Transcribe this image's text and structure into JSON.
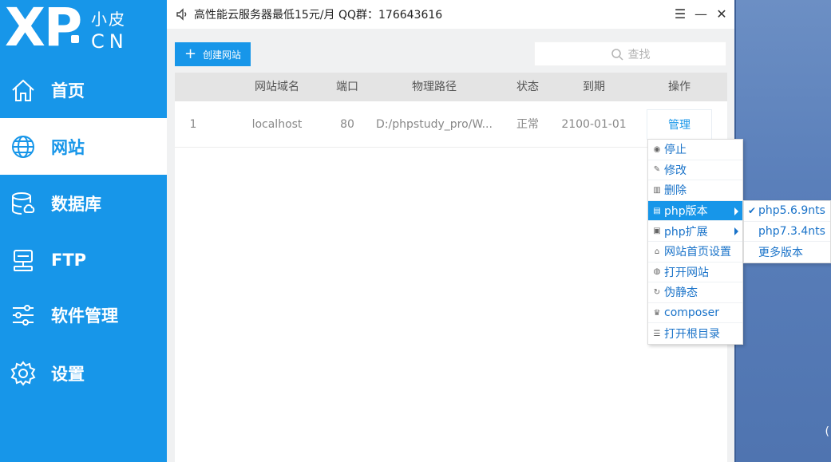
{
  "logo": {
    "main": "XP",
    "cn_top": "小皮",
    "cn_bottom": "CN"
  },
  "sidebar": {
    "items": [
      {
        "label": "首页",
        "icon": "home-icon"
      },
      {
        "label": "网站",
        "icon": "globe-icon",
        "active": true
      },
      {
        "label": "数据库",
        "icon": "database-icon"
      },
      {
        "label": "FTP",
        "icon": "server-icon"
      },
      {
        "label": "软件管理",
        "icon": "sliders-icon"
      },
      {
        "label": "设置",
        "icon": "gear-icon"
      }
    ]
  },
  "titlebar": {
    "notice": "高性能云服务器最低15元/月  QQ群：176643616",
    "buttons": {
      "menu": "☰",
      "minimize": "—",
      "close": "✕"
    }
  },
  "toolbar": {
    "create_label": "创建网站",
    "search_placeholder": "查找"
  },
  "table": {
    "headers": [
      "网站域名",
      "端口",
      "物理路径",
      "状态",
      "到期",
      "操作"
    ],
    "rows": [
      {
        "index": "1",
        "domain": "localhost",
        "port": "80",
        "path": "D:/phpstudy_pro/W...",
        "status": "正常",
        "expire": "2100-01-01",
        "action": "管理"
      }
    ]
  },
  "context_menu": {
    "items": [
      {
        "label": "停止",
        "icon": "stop-icon"
      },
      {
        "label": "修改",
        "icon": "edit-icon"
      },
      {
        "label": "删除",
        "icon": "trash-icon"
      },
      {
        "label": "php版本",
        "icon": "php-icon",
        "submenu": true,
        "highlighted": true
      },
      {
        "label": "php扩展",
        "icon": "extension-icon",
        "submenu": true
      },
      {
        "label": "网站首页设置",
        "icon": "home-small-icon"
      },
      {
        "label": "打开网站",
        "icon": "globe-small-icon"
      },
      {
        "label": "伪静态",
        "icon": "refresh-icon"
      },
      {
        "label": "composer",
        "icon": "composer-icon"
      },
      {
        "label": "打开根目录",
        "icon": "list-icon"
      }
    ]
  },
  "php_submenu": {
    "items": [
      {
        "label": "php5.6.9nts",
        "checked": true
      },
      {
        "label": "php7.3.4nts",
        "checked": false
      },
      {
        "label": "更多版本",
        "checked": false
      }
    ]
  },
  "colors": {
    "primary": "#1796e9",
    "link": "#1a73c9",
    "header_bg": "#e4e4e4"
  }
}
